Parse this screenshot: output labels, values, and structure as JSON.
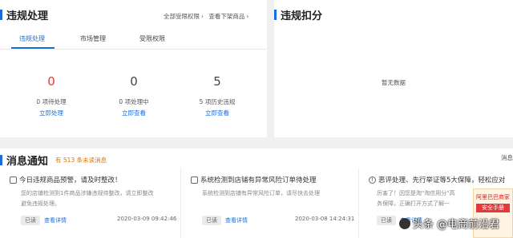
{
  "violation": {
    "title": "违规处理",
    "links": [
      "全部受限权限",
      "查看下架商品"
    ],
    "tabs": [
      "违规处理",
      "市场管理",
      "受限权限"
    ],
    "stats": [
      {
        "value": "0",
        "label": "0 项待处理",
        "link": "立即处理"
      },
      {
        "value": "0",
        "label": "0 项处理中",
        "link": "立即查看"
      },
      {
        "value": "5",
        "label": "5 项历史违规",
        "link": "立即查看"
      }
    ]
  },
  "deduction": {
    "title": "违规扣分",
    "empty_text": "暂无数据"
  },
  "notices": {
    "title": "消息通知",
    "unread": "有 513 条未读消息",
    "more": "消息",
    "cards": [
      {
        "title": "今日违规商品预警，请及时整改！",
        "desc": [
          "您的店铺检测到1件商品涉嫌违规待整改，请立即整改",
          "避免违规处理。"
        ],
        "status": "已读",
        "detail": "查看详情",
        "date": "2020-03-09 09:42:46"
      },
      {
        "title": "系统检测到店铺有异常风险订单待处理",
        "desc": [
          "系统检测到店铺有异常风险订单，请尽快去处理"
        ],
        "status": "已读",
        "detail": "查看详情",
        "date": "2020-03-08 14:24:31"
      },
      {
        "title": "恶评处理、先行举证等5大保障，轻松应对",
        "desc": [
          "厉害了！因您是淘\"淘信用分\"高",
          "务保障，正确打开方式了解一"
        ],
        "status": "已读",
        "detail": "查看详情",
        "date": ""
      }
    ]
  },
  "ad": {
    "line1": "阿里巴巴商家",
    "line2": "安全手册"
  },
  "watermark": "头条 @电商前沿君"
}
